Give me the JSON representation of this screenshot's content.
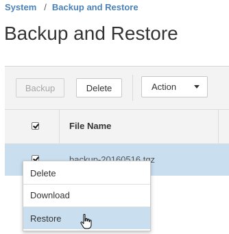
{
  "breadcrumb": {
    "parent": "System",
    "separator": "/",
    "current": "Backup and Restore"
  },
  "page": {
    "title": "Backup and Restore"
  },
  "toolbar": {
    "backup_label": "Backup",
    "delete_label": "Delete",
    "action_label": "Action"
  },
  "table": {
    "columns": [
      "File Name"
    ],
    "rows": [
      {
        "file_name": "backup-20160516.tgz",
        "selected": true
      }
    ]
  },
  "context_menu": {
    "items": [
      {
        "label": "Delete"
      },
      {
        "label": "Download"
      },
      {
        "label": "Restore",
        "hovered": true
      }
    ]
  },
  "colors": {
    "link": "#4a82b8",
    "selection": "#c9dff0"
  }
}
